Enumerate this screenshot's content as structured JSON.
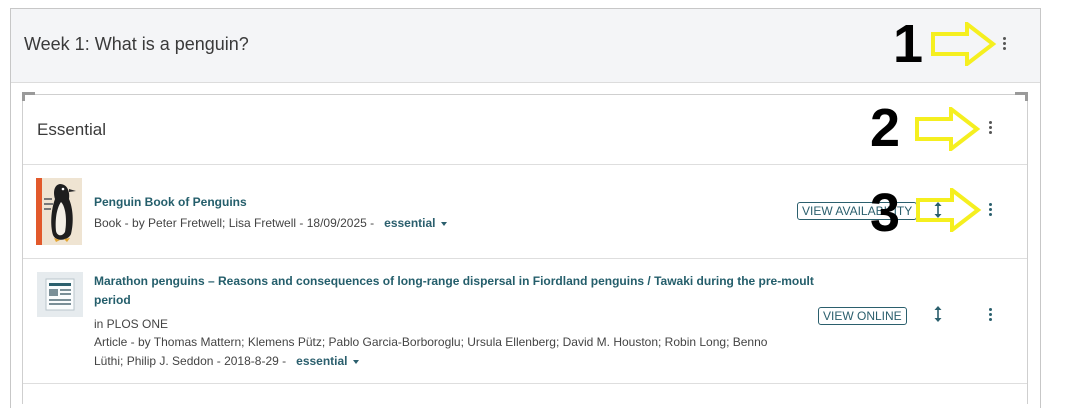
{
  "week": {
    "title": "Week 1: What is a penguin?"
  },
  "section": {
    "title": "Essential"
  },
  "items": [
    {
      "title": "Penguin Book of Penguins",
      "meta_line": "Book   -   by Peter Fretwell; Lisa Fretwell   -   18/09/2025   -",
      "tag": "essential",
      "button": "VIEW AVAILABILITY"
    },
    {
      "title_line1": "Marathon penguins – Reasons and consequences of long-range dispersal in Fiordland penguins / Tawaki during the pre-moult",
      "title_line2": "period",
      "source": "in PLOS ONE",
      "meta_line1": "Article   -   by Thomas Mattern; Klemens Pütz; Pablo Garcia-Borboroglu; Ursula Ellenberg; David M. Houston; Robin Long; Benno",
      "meta_line2": "Lüthi; Philip J. Seddon   -   2018-8-29   -",
      "tag": "essential",
      "button": "VIEW ONLINE"
    }
  ],
  "annotations": {
    "n1": "1",
    "n2": "2",
    "n3": "3"
  },
  "icons": {
    "kebab": "more-vertical-icon",
    "move": "move-vertical-icon",
    "arrow": "arrow-right-outline"
  },
  "colors": {
    "accent": "#2b5f6d",
    "arrow": "#f5ef1f",
    "header_bg": "#f4f5f7"
  }
}
